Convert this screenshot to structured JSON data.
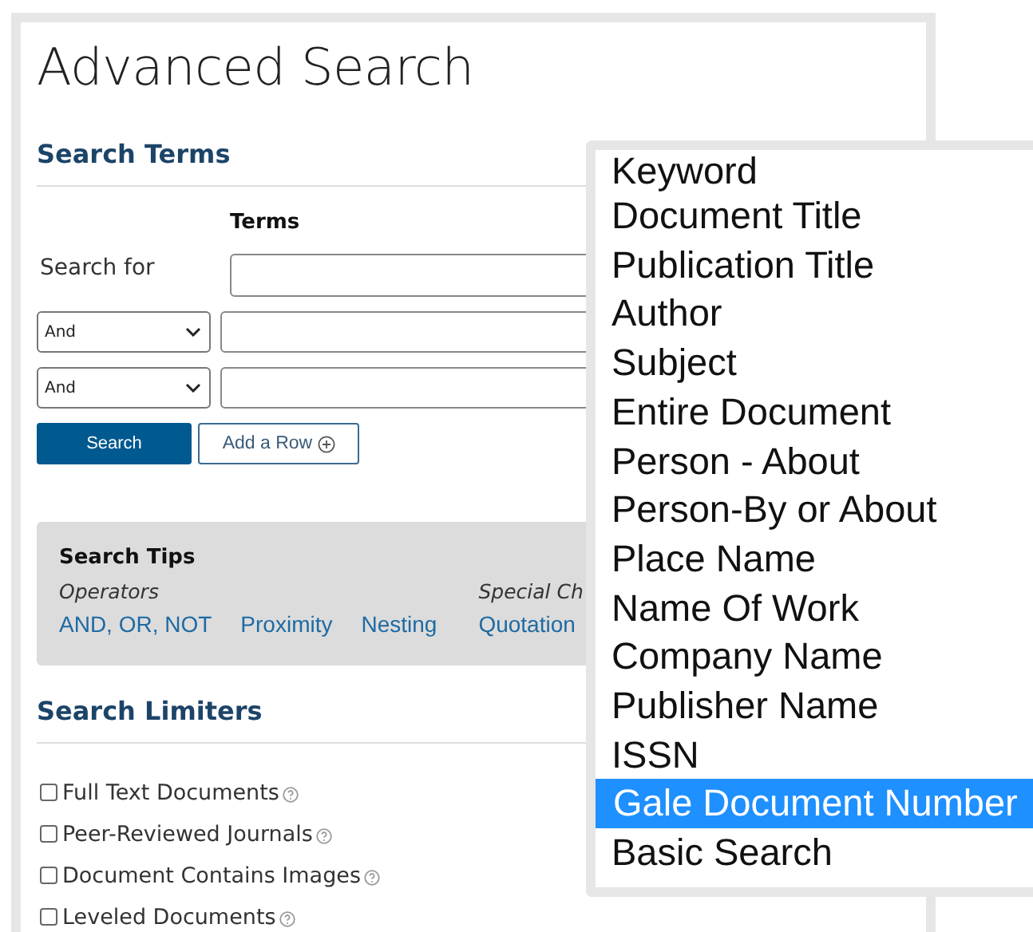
{
  "title": "Advanced Search",
  "search_terms": {
    "heading": "Search Terms",
    "column_header": "Terms",
    "rows": [
      {
        "kind": "label",
        "label": "Search for"
      },
      {
        "kind": "operator",
        "operator": "And"
      },
      {
        "kind": "operator",
        "operator": "And"
      }
    ],
    "buttons": {
      "search": "Search",
      "add_row": "Add a Row"
    }
  },
  "search_tips": {
    "heading": "Search Tips",
    "groups": [
      {
        "title": "Operators",
        "links": [
          "AND, OR, NOT",
          "Proximity",
          "Nesting"
        ]
      },
      {
        "title": "Special Ch",
        "links": [
          "Quotation"
        ]
      }
    ]
  },
  "search_limiters": {
    "heading": "Search Limiters",
    "options": [
      {
        "label": "Full Text Documents",
        "checked": false
      },
      {
        "label": "Peer-Reviewed Journals",
        "checked": false
      },
      {
        "label": "Document Contains Images",
        "checked": false
      },
      {
        "label": "Leveled Documents",
        "checked": false
      }
    ]
  },
  "dropdown": {
    "options": [
      {
        "label": "Keyword",
        "selected": false
      },
      {
        "label": "Document Title",
        "selected": false
      },
      {
        "label": "Publication Title",
        "selected": false
      },
      {
        "label": "Author",
        "selected": false
      },
      {
        "label": "Subject",
        "selected": false
      },
      {
        "label": "Entire Document",
        "selected": false
      },
      {
        "label": "Person - About",
        "selected": false
      },
      {
        "label": "Person-By or About",
        "selected": false
      },
      {
        "label": "Place Name",
        "selected": false
      },
      {
        "label": "Name Of Work",
        "selected": false
      },
      {
        "label": "Company Name",
        "selected": false
      },
      {
        "label": "Publisher Name",
        "selected": false
      },
      {
        "label": "ISSN",
        "selected": false
      },
      {
        "label": "Gale Document Number",
        "selected": true
      },
      {
        "label": "Basic Search",
        "selected": false
      }
    ]
  }
}
